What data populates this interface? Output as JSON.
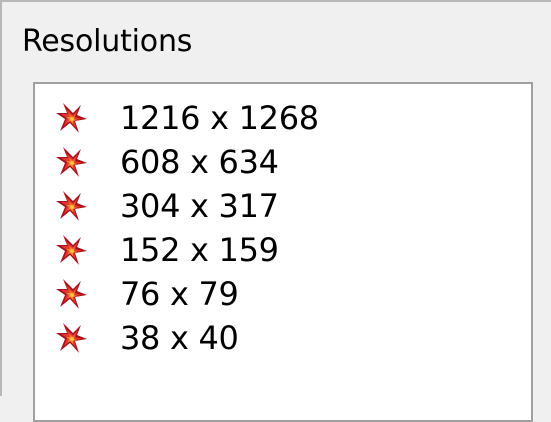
{
  "groupbox": {
    "title": "Resolutions"
  },
  "list": {
    "icon": "resolution-icon",
    "items": [
      {
        "label": "1216 x 1268"
      },
      {
        "label": "608 x 634"
      },
      {
        "label": "304 x 317"
      },
      {
        "label": "152 x 159"
      },
      {
        "label": "76 x 79"
      },
      {
        "label": "38 x 40"
      }
    ]
  },
  "colors": {
    "icon_dark_red": "#a8101c",
    "icon_red": "#e23a2c",
    "icon_orange": "#f08a2c",
    "icon_yellow": "#f6c744"
  }
}
